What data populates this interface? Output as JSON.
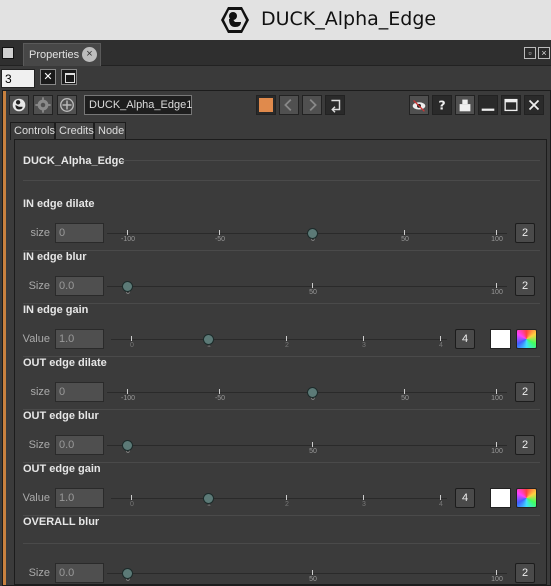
{
  "window": {
    "title": "DUCK_Alpha_Edge",
    "logo_icon": "duck-logo-icon"
  },
  "panel": {
    "tab_label": "Properties"
  },
  "stack": {
    "count": "3"
  },
  "node": {
    "name": "DUCK_Alpha_Edge1",
    "tile_color": "#e08a4c",
    "tabs": [
      "Controls",
      "Credits",
      "Node"
    ],
    "group_title": "DUCK_Alpha_Edge"
  },
  "sections": {
    "in_dilate": {
      "title": "IN edge dilate",
      "label": "size",
      "value": "0",
      "spin": "2",
      "slider_value": 0,
      "ticks": [
        "-100",
        "-50",
        "0",
        "50",
        "100"
      ]
    },
    "in_blur": {
      "title": "IN edge blur",
      "label": "Size",
      "value": "0.0",
      "spin": "2",
      "slider_value": 0,
      "ticks": [
        "0",
        "50",
        "100"
      ]
    },
    "in_gain": {
      "title": "IN edge gain",
      "label": "Value",
      "value": "1.0",
      "spin": "4",
      "slider_value": 1,
      "ticks": [
        "0",
        "1",
        "2",
        "3",
        "4"
      ]
    },
    "out_dilate": {
      "title": "OUT edge dilate",
      "label": "size",
      "value": "0",
      "spin": "2",
      "slider_value": 0,
      "ticks": [
        "-100",
        "-50",
        "0",
        "50",
        "100"
      ]
    },
    "out_blur": {
      "title": "OUT edge blur",
      "label": "Size",
      "value": "0.0",
      "spin": "2",
      "slider_value": 0,
      "ticks": [
        "0",
        "50",
        "100"
      ]
    },
    "out_gain": {
      "title": "OUT edge gain",
      "label": "Value",
      "value": "1.0",
      "spin": "4",
      "slider_value": 1,
      "ticks": [
        "0",
        "1",
        "2",
        "3",
        "4"
      ]
    },
    "overall_blur": {
      "title": "OVERALL blur",
      "label": "Size",
      "value": "0.0",
      "spin": "2",
      "slider_value": 0,
      "ticks": [
        "0",
        "50",
        "100"
      ]
    }
  }
}
